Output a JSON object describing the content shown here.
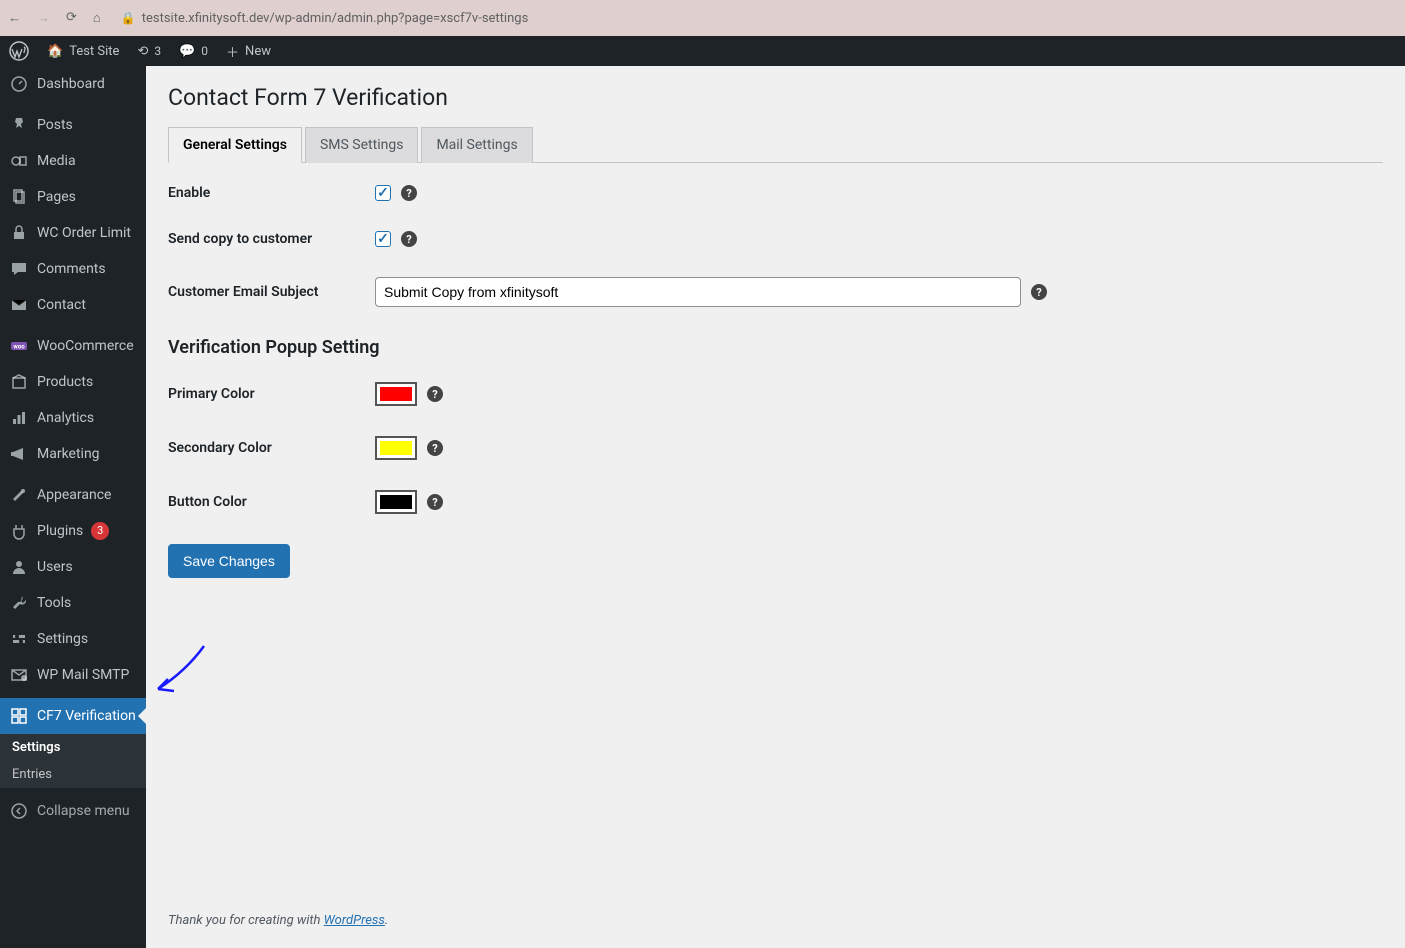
{
  "browser": {
    "url_display": "testsite.xfinitysoft.dev/wp-admin/admin.php?page=xscf7v-settings"
  },
  "topbar": {
    "site_name": "Test Site",
    "updates_count": "3",
    "comments_count": "0",
    "new_label": "New"
  },
  "sidebar": {
    "dashboard": "Dashboard",
    "posts": "Posts",
    "media": "Media",
    "pages": "Pages",
    "wc_order_limit": "WC Order Limit",
    "comments": "Comments",
    "contact": "Contact",
    "woocommerce": "WooCommerce",
    "products": "Products",
    "analytics": "Analytics",
    "marketing": "Marketing",
    "appearance": "Appearance",
    "plugins": "Plugins",
    "plugins_count": "3",
    "users": "Users",
    "tools": "Tools",
    "settings": "Settings",
    "wp_mail_smtp": "WP Mail SMTP",
    "cf7_verification": "CF7 Verification",
    "submenu_settings": "Settings",
    "submenu_entries": "Entries",
    "collapse": "Collapse menu"
  },
  "page": {
    "title": "Contact Form 7 Verification",
    "tabs": {
      "general": "General Settings",
      "sms": "SMS Settings",
      "mail": "Mail Settings"
    },
    "fields": {
      "enable_label": "Enable",
      "send_copy_label": "Send copy to customer",
      "email_subject_label": "Customer Email Subject",
      "email_subject_value": "Submit Copy from xfinitysoft",
      "section_title": "Verification Popup Setting",
      "primary_color_label": "Primary Color",
      "secondary_color_label": "Secondary Color",
      "button_color_label": "Button Color"
    },
    "colors": {
      "primary": "#FF0000",
      "secondary": "#FFFF00",
      "button": "#000000"
    },
    "submit_label": "Save Changes"
  },
  "footer": {
    "text_prefix": "Thank you for creating with ",
    "link_text": "WordPress",
    "text_suffix": "."
  }
}
